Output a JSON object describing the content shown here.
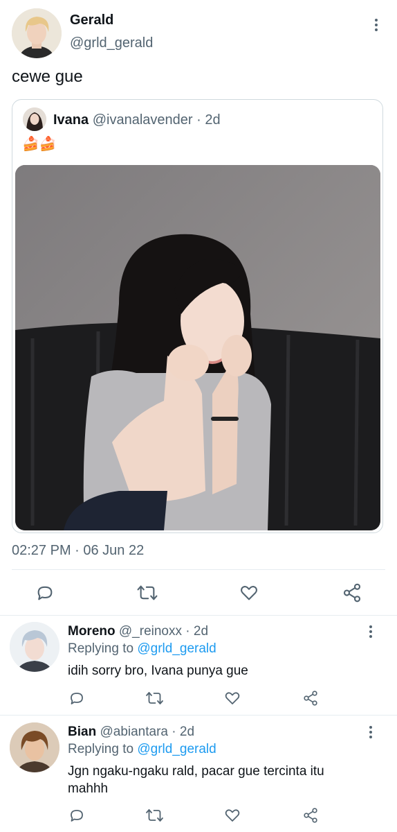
{
  "tweet": {
    "author_name": "Gerald",
    "author_handle": "@grld_gerald",
    "text": "cewe gue",
    "timestamp": "02:27 PM · 06 Jun 22",
    "more_icon": "more-vertical-icon"
  },
  "quote": {
    "author_name": "Ivana",
    "author_handle": "@ivanalavender",
    "separator": "·",
    "time": "2d",
    "text": "🍰🍰"
  },
  "actions": [
    "reply-icon",
    "retweet-icon",
    "like-icon",
    "share-icon"
  ],
  "replies": [
    {
      "name": "Moreno",
      "handle": "@_reinoxx",
      "time": "· 2d",
      "replying_label": "Replying to",
      "replying_to": "@grld_gerald",
      "text": "idih sorry bro, Ivana punya gue"
    },
    {
      "name": "Bian",
      "handle": "@abiantara",
      "time": "· 2d",
      "replying_label": "Replying to",
      "replying_to": "@grld_gerald",
      "text": "Jgn ngaku-ngaku rald, pacar gue tercinta itu mahhh"
    }
  ],
  "colors": {
    "text": "#0f1419",
    "secondary": "#536471",
    "link": "#1d9bf0",
    "border": "#cfd9de"
  }
}
